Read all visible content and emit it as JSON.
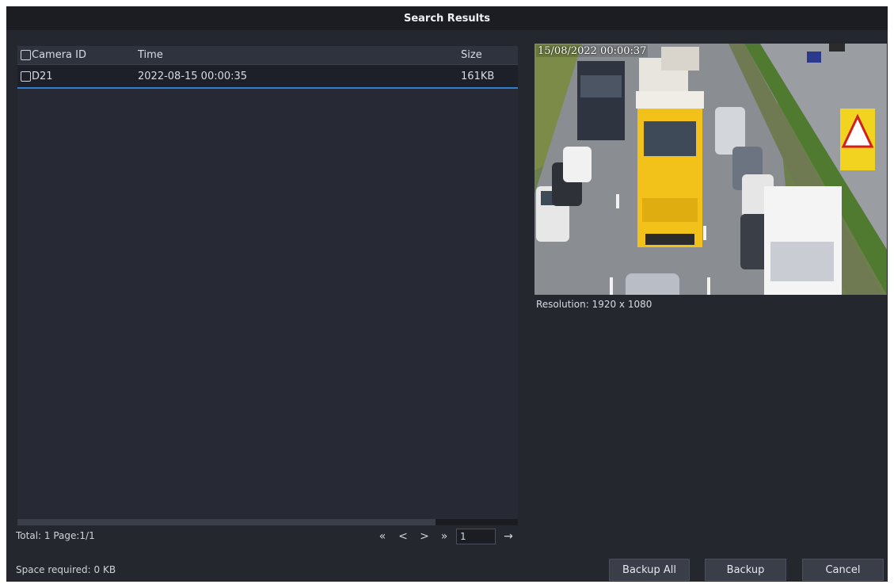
{
  "window": {
    "title": "Search Results"
  },
  "table": {
    "columns": {
      "camera_id": "Camera ID",
      "time": "Time",
      "size": "Size"
    },
    "rows": [
      {
        "camera_id": "D21",
        "time": "2022-08-15 00:00:35",
        "size": "161KB"
      }
    ]
  },
  "pagination": {
    "summary": "Total: 1  Page:1/1",
    "first_icon": "«",
    "prev_icon": "<",
    "next_icon": ">",
    "last_icon": "»",
    "page_value": "1",
    "go_icon": "→"
  },
  "preview": {
    "timestamp": "15/08/2022 00:00:37",
    "resolution": "Resolution: 1920 x 1080"
  },
  "footer": {
    "space_required": "Space required: 0 KB",
    "backup_all_label": "Backup All",
    "backup_label": "Backup",
    "cancel_label": "Cancel"
  }
}
